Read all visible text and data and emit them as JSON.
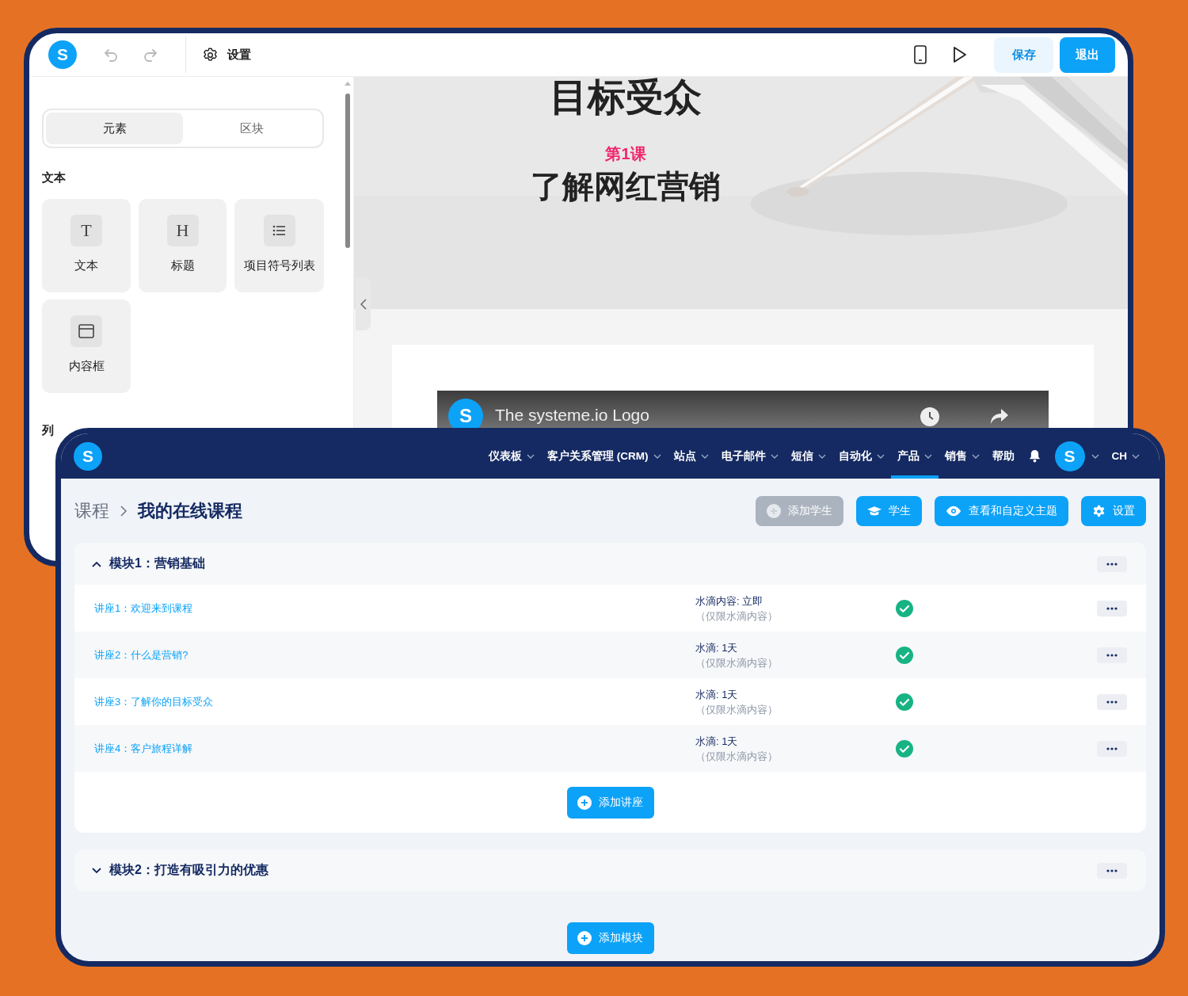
{
  "editor": {
    "logo": "S",
    "settings_label": "设置",
    "save_label": "保存",
    "exit_label": "退出",
    "tabs": [
      {
        "label": "元素",
        "selected": true
      },
      {
        "label": "区块",
        "selected": false
      }
    ],
    "section_title": "文本",
    "tiles": [
      {
        "kind": "glyph",
        "glyph": "T",
        "label": "文本"
      },
      {
        "kind": "glyph",
        "glyph": "H",
        "label": "标题"
      },
      {
        "kind": "list",
        "label": "项目符号列表"
      },
      {
        "kind": "box",
        "label": "内容框"
      }
    ],
    "next_section_title": "列",
    "canvas": {
      "heading": "目标受众",
      "lesson_label": "第1课",
      "lesson_title": "了解网红营销",
      "video_logo": "S",
      "video_title": "The systeme.io Logo"
    }
  },
  "dashboard": {
    "logo": "S",
    "nav": [
      {
        "label": "仪表板",
        "dropdown": true,
        "selected": false
      },
      {
        "label": "客户关系管理 (CRM)",
        "dropdown": true,
        "selected": false
      },
      {
        "label": "站点",
        "dropdown": true,
        "selected": false
      },
      {
        "label": "电子邮件",
        "dropdown": true,
        "selected": false
      },
      {
        "label": "短信",
        "dropdown": true,
        "selected": false
      },
      {
        "label": "自动化",
        "dropdown": true,
        "selected": false
      },
      {
        "label": "产品",
        "dropdown": true,
        "selected": true
      },
      {
        "label": "销售",
        "dropdown": true,
        "selected": false
      },
      {
        "label": "帮助",
        "dropdown": false,
        "selected": false
      }
    ],
    "avatar": "S",
    "language": "CH",
    "breadcrumb": {
      "parent": "课程",
      "current": "我的在线课程"
    },
    "actions": [
      {
        "kind": "add",
        "label": "添加学生",
        "disabled": true
      },
      {
        "kind": "students",
        "label": "学生",
        "disabled": false
      },
      {
        "kind": "view",
        "label": "查看和自定义主题",
        "disabled": false
      },
      {
        "kind": "settings",
        "label": "设置",
        "disabled": false
      }
    ],
    "modules": [
      {
        "title": "模块1：营销基础",
        "expanded": true,
        "add_label": "添加讲座",
        "lectures": [
          {
            "title": "讲座1：欢迎来到课程",
            "drip": "水滴内容: 立即",
            "note": "（仅限水滴内容）",
            "published": true
          },
          {
            "title": "讲座2：什么是营销?",
            "drip": "水滴: 1天",
            "note": "（仅限水滴内容）",
            "published": true
          },
          {
            "title": "讲座3：了解你的目标受众",
            "drip": "水滴: 1天",
            "note": "（仅限水滴内容）",
            "published": true
          },
          {
            "title": "讲座4：客户旅程详解",
            "drip": "水滴: 1天",
            "note": "（仅限水滴内容）",
            "published": true
          }
        ]
      },
      {
        "title": "模块2：打造有吸引力的优惠",
        "expanded": false
      }
    ],
    "add_module_label": "添加模块"
  }
}
